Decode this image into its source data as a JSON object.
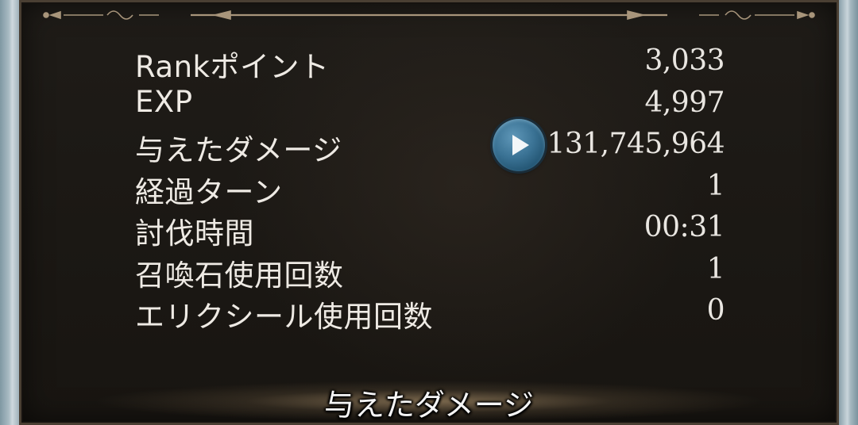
{
  "results": {
    "rows": [
      {
        "label": "Rankポイント",
        "value": "3,033"
      },
      {
        "label": "EXP",
        "value": "4,997"
      },
      {
        "label": "与えたダメージ",
        "value": "131,745,964"
      },
      {
        "label": "経過ターン",
        "value": "1"
      },
      {
        "label": "討伐時間",
        "value": "00:31"
      },
      {
        "label": "召喚石使用回数",
        "value": "1"
      },
      {
        "label": "エリクシール使用回数",
        "value": "0"
      }
    ]
  },
  "play_button": {
    "icon": "play-icon",
    "color": "#3a7294"
  },
  "subtitle": {
    "text": "与えたダメージ"
  }
}
